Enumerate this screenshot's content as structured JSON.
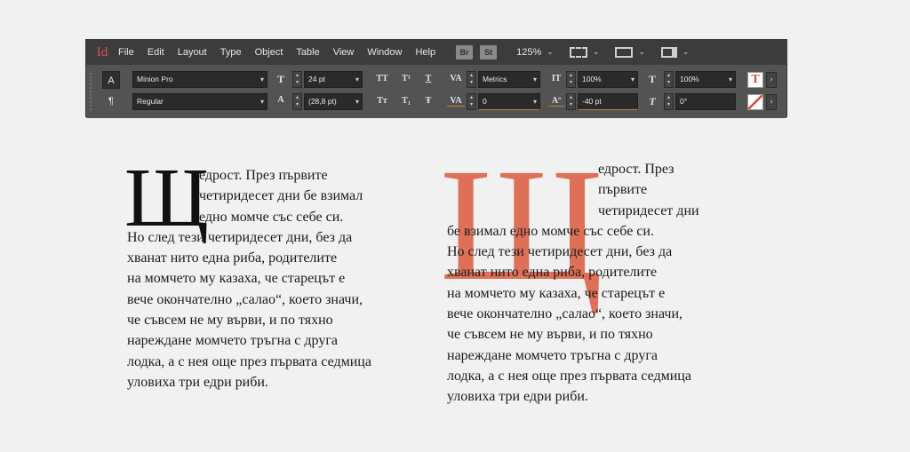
{
  "app": {
    "logo": "Id",
    "menu": [
      "File",
      "Edit",
      "Layout",
      "Type",
      "Object",
      "Table",
      "View",
      "Window",
      "Help"
    ],
    "menu_underline": [
      "F",
      "E",
      "L",
      "T",
      "O",
      "a",
      "V",
      "W",
      "H"
    ],
    "badges": [
      "Br",
      "St"
    ],
    "zoom": "125%"
  },
  "control_panel": {
    "char_mode": "A",
    "para_mode": "¶",
    "font_family": "Minion Pro",
    "font_style": "Regular",
    "font_size": "24 pt",
    "leading": "(28,8 pt)",
    "kerning": "Metrics",
    "tracking": "0",
    "vertical_scale": "100%",
    "horizontal_scale": "100%",
    "baseline_shift": "-40 pt",
    "skew": "0°"
  },
  "sample_left": {
    "drop_cap": "Щ",
    "lines": [
      "едрост. През първите",
      "четиридесет дни бе взимал",
      "едно момче със себе си.",
      "Но след тези четиридесет дни, без да",
      "хванат нито една риба, родителите",
      "на момчето му казаха, че старецът е",
      "вече окончателно „салао“, което значи,",
      "че съвсем не му върви, и по тяхно",
      "нареждане момчето тръгна с друга",
      "лодка, а с нея още през първата седмица",
      "уловиха три едри риби."
    ]
  },
  "sample_right": {
    "drop_cap": "Щ",
    "drop_cap_color": "#de6c54",
    "lines": [
      "едрост. През",
      "първите",
      "четиридесет дни",
      "бе взимал едно момче със себе си.",
      "Но след тези четиридесет дни, без да",
      "хванат нито една риба, родителите",
      "на момчето му казаха, че старецът е",
      "вече окончателно „салао“, което значи,",
      "че съвсем не му върви, и по тяхно",
      "нареждане момчето тръгна с друга",
      "лодка, а с нея още през първата седмица",
      "уловиха три едри риби."
    ]
  }
}
